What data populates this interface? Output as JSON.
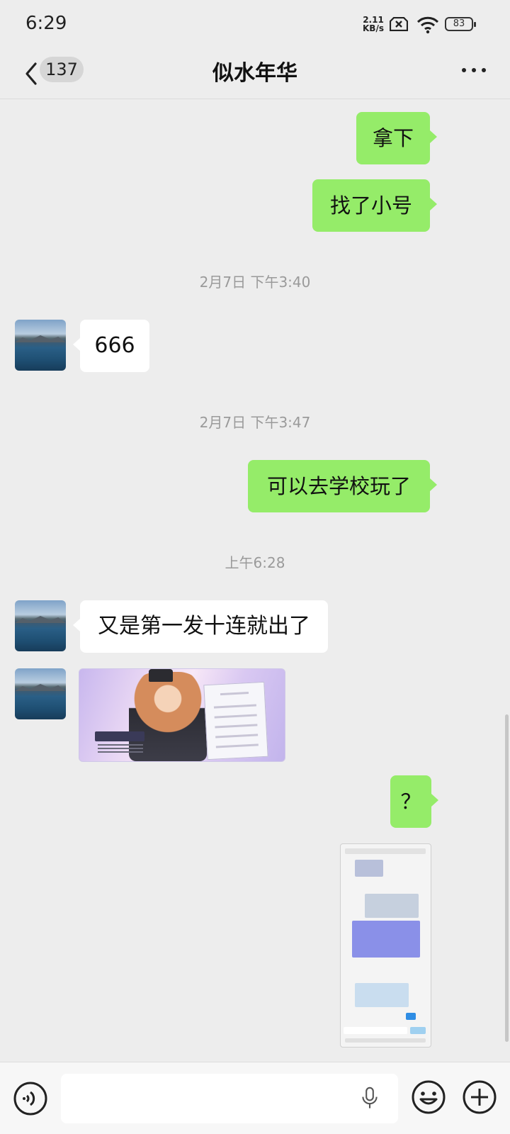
{
  "status_bar": {
    "time": "6:29",
    "net_speed_value": "2.11",
    "net_speed_unit": "KB/s",
    "battery": "83"
  },
  "header": {
    "unread_count": "137",
    "title": "似水年华",
    "back_icon": "chevron-left-icon",
    "more_icon": "more-dots-icon"
  },
  "messages": [
    {
      "side": "right",
      "type": "text",
      "text": "拿下"
    },
    {
      "side": "right",
      "type": "text",
      "text": "找了小号"
    },
    {
      "type": "timestamp",
      "text": "2月7日 下午3:40"
    },
    {
      "side": "left",
      "type": "text",
      "text": "666"
    },
    {
      "type": "timestamp",
      "text": "2月7日 下午3:47"
    },
    {
      "side": "right",
      "type": "text",
      "text": "可以去学校玩了"
    },
    {
      "type": "timestamp",
      "text": "上午6:28"
    },
    {
      "side": "left",
      "type": "text",
      "text": "又是第一发十连就出了"
    },
    {
      "side": "left",
      "type": "image",
      "description_icon": "game-character-image"
    },
    {
      "side": "right",
      "type": "text",
      "text": "？"
    },
    {
      "side": "right",
      "type": "image",
      "description_icon": "chat-screenshot-image"
    }
  ],
  "bottom_bar": {
    "voice_icon": "voice-mode-icon",
    "mic_icon": "microphone-icon",
    "emoji_icon": "emoji-icon",
    "plus_icon": "plus-circle-icon"
  },
  "colors": {
    "bubble_self": "#95ec69",
    "bubble_other": "#ffffff",
    "background": "#ededed"
  }
}
